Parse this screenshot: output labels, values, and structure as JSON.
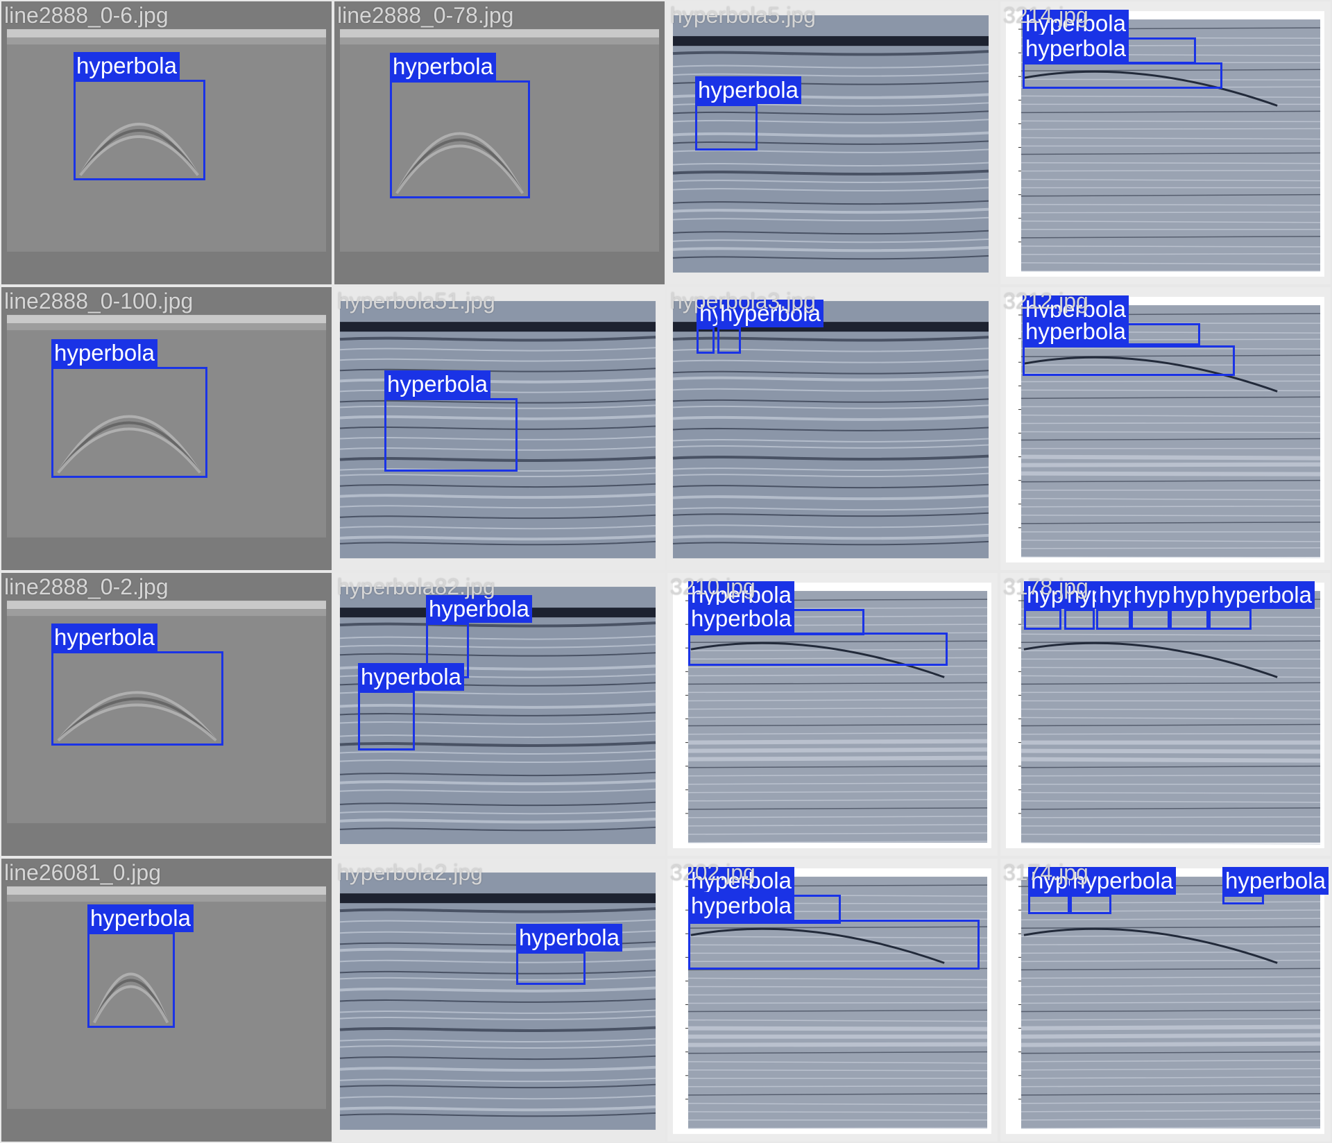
{
  "tiles": [
    {
      "filename": "line2888_0-6.jpg",
      "labels": [
        "hyperbola"
      ]
    },
    {
      "filename": "line2888_0-78.jpg",
      "labels": [
        "hyperbola"
      ]
    },
    {
      "filename": "hyperbola5.jpg",
      "labels": [
        "hyperbola"
      ]
    },
    {
      "filename": "3214.jpg",
      "labels": [
        "hyperbola",
        "hyperbola"
      ]
    },
    {
      "filename": "line2888_0-100.jpg",
      "labels": [
        "hyperbola"
      ]
    },
    {
      "filename": "hyperbola51.jpg",
      "labels": [
        "hyperbola"
      ]
    },
    {
      "filename": "hyperbola3.jpg",
      "labels": [
        "hyperbola",
        "hyperbola"
      ]
    },
    {
      "filename": "3212.jpg",
      "labels": [
        "hyperbola",
        "hyperbola"
      ]
    },
    {
      "filename": "line2888_0-2.jpg",
      "labels": [
        "hyperbola"
      ]
    },
    {
      "filename": "hyperbola82.jpg",
      "labels": [
        "hyperbola",
        "hyperbola"
      ]
    },
    {
      "filename": "3210.jpg",
      "labels": [
        "hyperbola",
        "hyperbola"
      ]
    },
    {
      "filename": "3178.jpg",
      "labels": [
        "hyperbola",
        "hyperbola",
        "hyperbola",
        "hyperbola",
        "hyperbola",
        "hyperbola"
      ]
    },
    {
      "filename": "line26081_0.jpg",
      "labels": [
        "hyperbola"
      ]
    },
    {
      "filename": "hyperbola2.jpg",
      "labels": [
        "hyperbola"
      ]
    },
    {
      "filename": "3202.jpg",
      "labels": [
        "hyperbola",
        "hyperbola"
      ]
    },
    {
      "filename": "3174.jpg",
      "labels": [
        "hyperbola",
        "hyperbola",
        "hyperbola"
      ]
    }
  ],
  "colors": {
    "box": "#1a33e6",
    "label_text": "#ffffff",
    "tile_gray": "#7b7b7b",
    "radar_blue": "#8b96a8"
  }
}
